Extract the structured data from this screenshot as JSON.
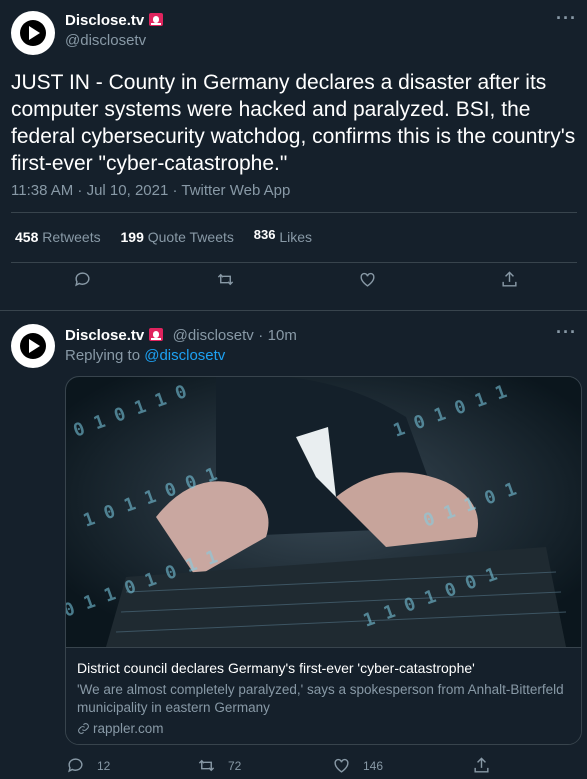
{
  "main_tweet": {
    "author_name": "Disclose.tv",
    "handle": "@disclosetv",
    "text": "JUST IN - County in Germany declares a disaster after its computer systems were hacked and paralyzed. BSI, the federal cybersecurity watchdog, confirms this is the country's first-ever \"cyber-catastrophe.\"",
    "meta": "11:38 AM · Jul 10, 2021 · Twitter Web App",
    "stats": {
      "retweets_count": "458",
      "retweets_label": "Retweets",
      "quotes_count": "199",
      "quotes_label": "Quote Tweets",
      "likes_count": "836",
      "likes_label": "Likes"
    },
    "more": "···"
  },
  "reply_tweet": {
    "author_name": "Disclose.tv",
    "handle": "@disclosetv",
    "dot": "·",
    "time": "10m",
    "replying_prefix": "Replying to",
    "replying_handle": "@disclosetv",
    "more": "···",
    "card": {
      "title": "District council declares Germany's first-ever 'cyber-catastrophe'",
      "description": "'We are almost completely paralyzed,' says a spokesperson from Anhalt-Bitterfeld municipality in eastern Germany",
      "domain": "rappler.com"
    },
    "actions": {
      "reply_count": "12",
      "retweet_count": "72",
      "like_count": "146"
    }
  },
  "icons": {
    "avatar": "disclose-logo-icon",
    "badge": "siren-icon",
    "reply": "reply-icon",
    "retweet": "retweet-icon",
    "like": "heart-icon",
    "share": "share-icon",
    "link": "link-icon"
  },
  "colors": {
    "background": "#15202b",
    "muted": "#8899a6",
    "accent": "#1da1f2",
    "divider": "#38444d",
    "siren": "#e0245e"
  }
}
